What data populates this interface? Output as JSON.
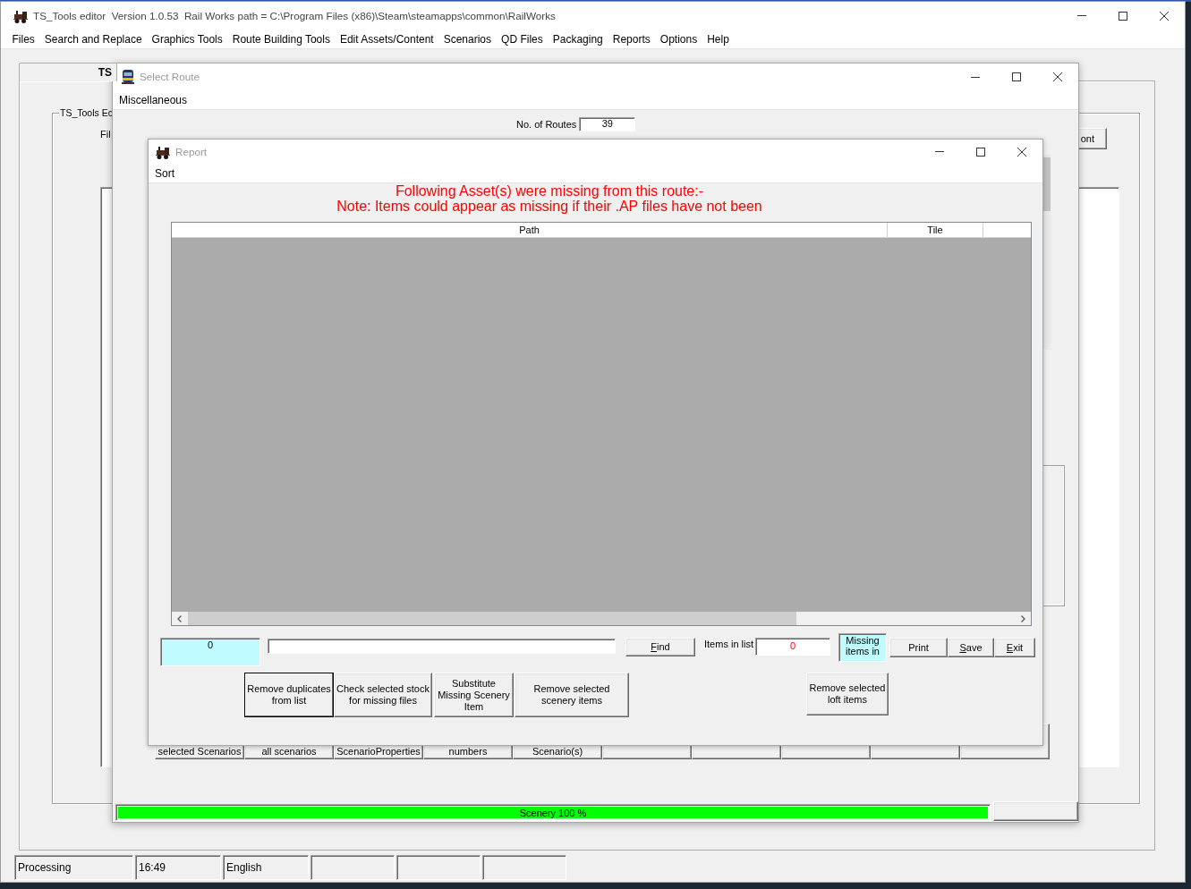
{
  "main_window": {
    "title": "TS_Tools editor  Version 1.0.53  Rail Works path = C:\\Program Files (x86)\\Steam\\steamapps\\common\\RailWorks",
    "menu": [
      "Files",
      "Search and Replace",
      "Graphics Tools",
      "Route Building Tools",
      "Edit Assets/Content",
      "Scenarios",
      "QD Files",
      "Packaging",
      "Reports",
      "Options",
      "Help"
    ],
    "tab": {
      "label": "TS",
      "selected": true
    },
    "group_box": {
      "label": "TS_Tools Ec",
      "field_label": "Fil",
      "side_button": "ont"
    },
    "status_bar": [
      {
        "kind": "text",
        "text": "Processing"
      },
      {
        "kind": "text",
        "text": "16:49"
      },
      {
        "kind": "text",
        "text": "English"
      },
      {
        "kind": "blank"
      },
      {
        "kind": "blank"
      },
      {
        "kind": "blank"
      }
    ]
  },
  "select_route_window": {
    "title": "Select Route",
    "active": false,
    "menu": [
      "Miscellaneous"
    ],
    "routes_label": "No. of Routes",
    "routes_count": "39",
    "list_buttons": [
      {
        "kind": "text",
        "label": "selected Scenarios"
      },
      {
        "kind": "text",
        "label": "all scenarios"
      },
      {
        "kind": "text",
        "label": "ScenarioProperties"
      },
      {
        "kind": "text",
        "label": "numbers"
      },
      {
        "kind": "text",
        "label": "Scenario(s)"
      },
      {
        "kind": "blank"
      },
      {
        "kind": "blank"
      },
      {
        "kind": "blank"
      },
      {
        "kind": "blank"
      },
      {
        "kind": "blank"
      }
    ],
    "progress": {
      "label": "Scenery 100 %",
      "level": 1
    }
  },
  "report_window": {
    "title": "Report",
    "active": false,
    "menu": [
      "Sort"
    ],
    "message_lines": [
      "Following Asset(s) were missing from this route:-",
      "Note: Items could appear as missing if their .AP files have not been"
    ],
    "table": {
      "columns": [
        "Path",
        "Tile"
      ]
    },
    "count_display": "0",
    "find_button": {
      "label": "Find",
      "mnemonic": true
    },
    "items_label": "Items in list",
    "items_count": "0",
    "missing_indicator": "Missing items in",
    "dialog_buttons": [
      {
        "label": "Print",
        "mnemonic": false
      },
      {
        "label": "Save",
        "mnemonic": true
      },
      {
        "label": "Exit",
        "mnemonic": true
      }
    ],
    "tool_buttons": [
      {
        "lines": [
          "Remove duplicates",
          "from list"
        ],
        "focused": true
      },
      {
        "lines": [
          "Check selected stock",
          "for missing files"
        ],
        "focused": false
      },
      {
        "lines": [
          "Substitute",
          "Missing Scenery",
          "Item"
        ],
        "focused": false
      },
      {
        "lines": [
          "Remove selected",
          "scenery items"
        ],
        "focused": false
      }
    ],
    "loft_button": {
      "lines": [
        "Remove selected",
        "loft items"
      ],
      "focused": false
    }
  }
}
